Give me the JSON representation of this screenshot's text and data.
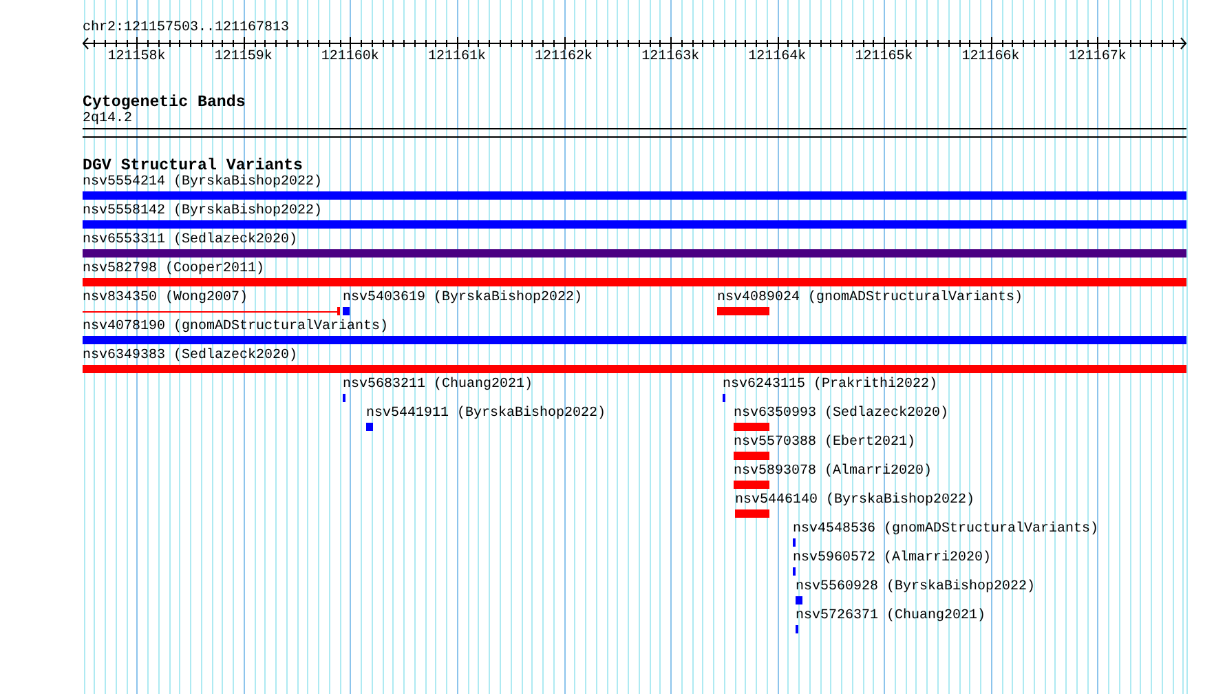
{
  "position": {
    "label": "chr2:121157503..121167813"
  },
  "ruler": {
    "ticks": [
      {
        "label": "121158k"
      },
      {
        "label": "121159k"
      },
      {
        "label": "121160k"
      },
      {
        "label": "121161k"
      },
      {
        "label": "121162k"
      },
      {
        "label": "121163k"
      },
      {
        "label": "121164k"
      },
      {
        "label": "121165k"
      },
      {
        "label": "121166k"
      },
      {
        "label": "121167k"
      }
    ]
  },
  "cytogenetic_bands": {
    "title": "Cytogenetic Bands",
    "bands": [
      {
        "name": "2q14.2"
      }
    ]
  },
  "structural_variants": {
    "title": "DGV Structural Variants",
    "rows": [
      {
        "features": [
          {
            "name": "nsv5554214 (ByrskaBishop2022)",
            "kind": "bar",
            "color": "#0000ff"
          }
        ]
      },
      {
        "features": [
          {
            "name": "nsv5558142 (ByrskaBishop2022)",
            "kind": "bar",
            "color": "#0000ff"
          }
        ]
      },
      {
        "features": [
          {
            "name": "nsv6553311 (Sedlazeck2020)",
            "kind": "bar",
            "color": "#4b0082"
          }
        ]
      },
      {
        "features": [
          {
            "name": "nsv582798 (Cooper2011)",
            "kind": "bar",
            "color": "#ff0000"
          }
        ]
      },
      {
        "features": [
          {
            "name": "nsv834350 (Wong2007)",
            "kind": "line",
            "color": "#ff0000"
          },
          {
            "name": "nsv5403619 (ByrskaBishop2022)",
            "kind": "bar",
            "color": "#0000ff"
          },
          {
            "name": "nsv4089024 (gnomADStructuralVariants)",
            "kind": "bar",
            "color": "#ff0000"
          }
        ]
      },
      {
        "features": [
          {
            "name": "nsv4078190 (gnomADStructuralVariants)",
            "kind": "bar",
            "color": "#0000ff"
          }
        ]
      },
      {
        "features": [
          {
            "name": "nsv6349383 (Sedlazeck2020)",
            "kind": "bar",
            "color": "#ff0000"
          }
        ]
      },
      {
        "features": [
          {
            "name": "nsv5683211 (Chuang2021)",
            "kind": "bar",
            "color": "#0000ff"
          },
          {
            "name": "nsv6243115 (Prakrithi2022)",
            "kind": "bar",
            "color": "#0000ff"
          }
        ]
      },
      {
        "features": [
          {
            "name": "nsv5441911 (ByrskaBishop2022)",
            "kind": "bar",
            "color": "#0000ff"
          },
          {
            "name": "nsv6350993 (Sedlazeck2020)",
            "kind": "bar",
            "color": "#ff0000"
          }
        ]
      },
      {
        "features": [
          {
            "name": "nsv5570388 (Ebert2021)",
            "kind": "bar",
            "color": "#ff0000"
          }
        ]
      },
      {
        "features": [
          {
            "name": "nsv5893078 (Almarri2020)",
            "kind": "bar",
            "color": "#ff0000"
          }
        ]
      },
      {
        "features": [
          {
            "name": "nsv5446140 (ByrskaBishop2022)",
            "kind": "bar",
            "color": "#ff0000"
          }
        ]
      },
      {
        "features": [
          {
            "name": "nsv4548536 (gnomADStructuralVariants)",
            "kind": "bar",
            "color": "#0000ff"
          }
        ]
      },
      {
        "features": [
          {
            "name": "nsv5960572 (Almarri2020)",
            "kind": "bar",
            "color": "#0000ff"
          }
        ]
      },
      {
        "features": [
          {
            "name": "nsv5560928 (ByrskaBishop2022)",
            "kind": "bar",
            "color": "#0000ff"
          }
        ]
      },
      {
        "features": [
          {
            "name": "nsv5726371 (Chuang2021)",
            "kind": "bar",
            "color": "#0000ff"
          }
        ]
      }
    ]
  }
}
